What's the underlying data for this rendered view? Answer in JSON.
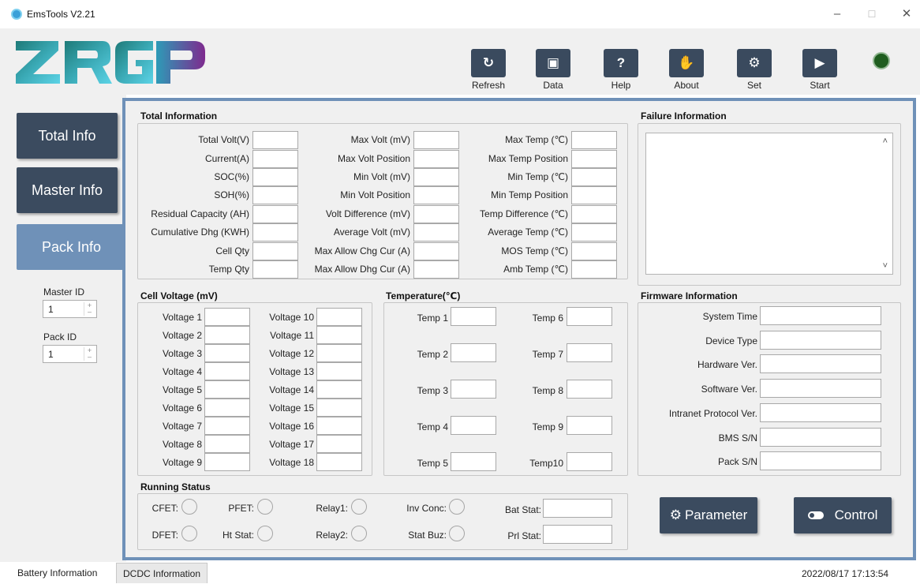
{
  "window": {
    "title": "EmsTools V2.21",
    "minimize": "–",
    "maximize": "☐",
    "close": "✕"
  },
  "brand": {
    "logo_text": "ZRGP"
  },
  "toolbar": [
    {
      "label": "Refresh",
      "icon": "refresh-icon",
      "glyph": "↻"
    },
    {
      "label": "Data",
      "icon": "save-icon",
      "glyph": "▣"
    },
    {
      "label": "Help",
      "icon": "help-icon",
      "glyph": "?"
    },
    {
      "label": "About",
      "icon": "hand-icon",
      "glyph": "✋"
    },
    {
      "label": "Set",
      "icon": "gear-icon",
      "glyph": "⚙"
    },
    {
      "label": "Start",
      "icon": "play-icon",
      "glyph": "▶"
    }
  ],
  "nav": {
    "total": "Total Info",
    "master": "Master Info",
    "pack": "Pack Info"
  },
  "ids": {
    "master_label": "Master ID",
    "master_value": "1",
    "pack_label": "Pack ID",
    "pack_value": "1",
    "up": "+",
    "down": "–"
  },
  "total_info": {
    "title": "Total Information",
    "col1": [
      "Total Volt(V)",
      "Current(A)",
      "SOC(%)",
      "SOH(%)",
      "Residual Capacity (AH)",
      "Cumulative Dhg (KWH)",
      "Cell Qty",
      "Temp Qty"
    ],
    "col2": [
      "Max Volt (mV)",
      "Max Volt Position",
      "Min Volt (mV)",
      "Min Volt Position",
      "Volt Difference (mV)",
      "Average Volt (mV)",
      "Max Allow Chg Cur (A)",
      "Max Allow Dhg Cur (A)"
    ],
    "col3": [
      "Max Temp (℃)",
      "Max Temp Position",
      "Min Temp (℃)",
      "Min Temp Position",
      "Temp Difference (℃)",
      "Average Temp (℃)",
      "MOS Temp (℃)",
      "Amb Temp (℃)"
    ]
  },
  "failure": {
    "title": "Failure Information",
    "scroll_up": "˄",
    "scroll_down": "˅"
  },
  "cell_voltage": {
    "title": "Cell Voltage (mV)",
    "col1": [
      "Voltage 1",
      "Voltage 2",
      "Voltage 3",
      "Voltage 4",
      "Voltage 5",
      "Voltage 6",
      "Voltage 7",
      "Voltage 8",
      "Voltage 9"
    ],
    "col2": [
      "Voltage 10",
      "Voltage 11",
      "Voltage 12",
      "Voltage 13",
      "Voltage 14",
      "Voltage 15",
      "Voltage 16",
      "Voltage 17",
      "Voltage 18"
    ]
  },
  "temperature": {
    "title": "Temperature(℃)",
    "col1": [
      "Temp 1",
      "Temp 2",
      "Temp 3",
      "Temp 4",
      "Temp 5"
    ],
    "col2": [
      "Temp  6",
      "Temp  7",
      "Temp  8",
      "Temp  9",
      "Temp10"
    ]
  },
  "firmware": {
    "title": "Firmware Information",
    "fields": [
      "System Time",
      "Device Type",
      "Hardware Ver.",
      "Software Ver.",
      "Intranet Protocol Ver.",
      "BMS S/N",
      "Pack S/N"
    ]
  },
  "running": {
    "title": "Running Status",
    "row1": [
      "CFET:",
      "PFET:",
      "Relay1:",
      "Inv Conc:"
    ],
    "row2": [
      "DFET:",
      "Ht Stat:",
      "Relay2:",
      "Stat Buz:"
    ],
    "bat_stat": "Bat Stat:",
    "prl_stat": "Prl Stat:"
  },
  "buttons": {
    "parameter": "Parameter",
    "control": "Control"
  },
  "tabs": {
    "battery": "Battery Information",
    "dcdc": "DCDC Information"
  },
  "status": {
    "datetime": "2022/08/17 17:13:54"
  }
}
